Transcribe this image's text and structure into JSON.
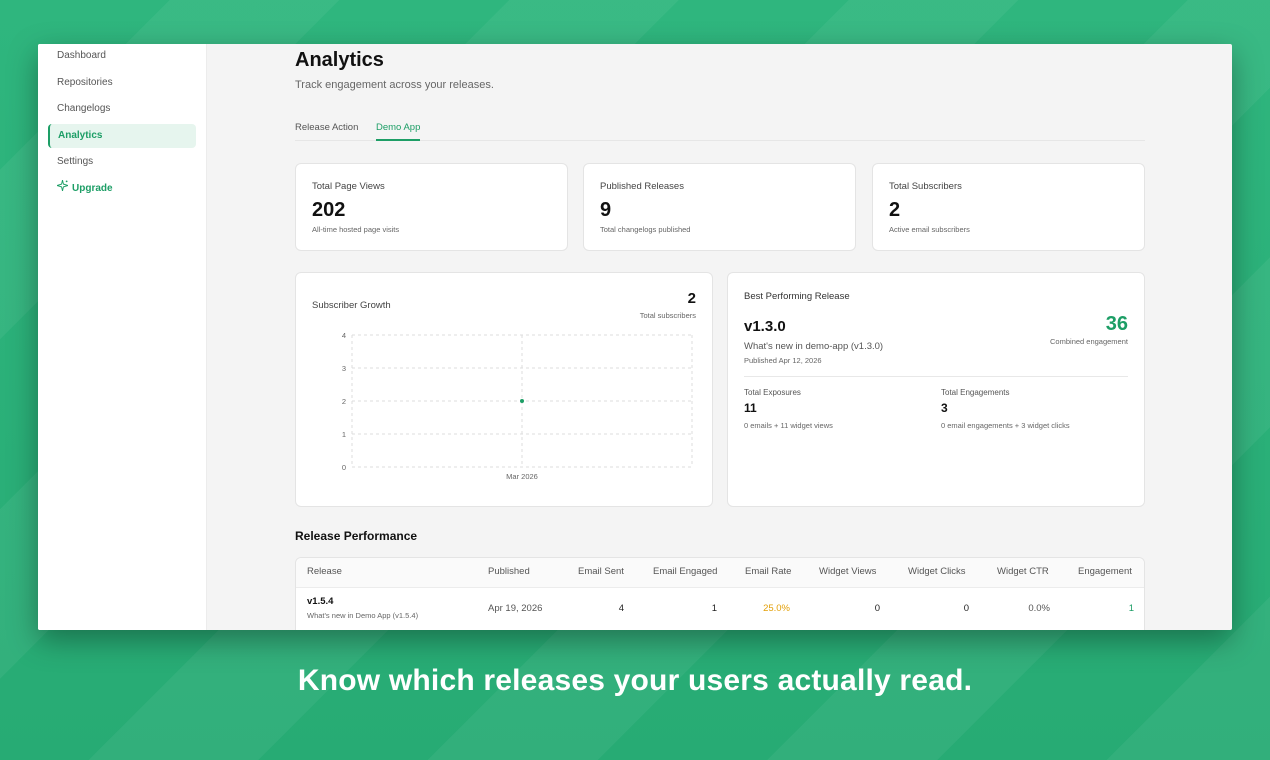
{
  "sidebar": {
    "items": [
      {
        "label": "Dashboard"
      },
      {
        "label": "Repositories"
      },
      {
        "label": "Changelogs"
      },
      {
        "label": "Analytics"
      },
      {
        "label": "Settings"
      },
      {
        "label": "Upgrade"
      }
    ]
  },
  "header": {
    "title": "Analytics",
    "subtitle": "Track engagement across your releases."
  },
  "tabs": [
    {
      "label": "Release Action"
    },
    {
      "label": "Demo App"
    }
  ],
  "stats": [
    {
      "label": "Total Page Views",
      "value": "202",
      "desc": "All-time hosted page visits"
    },
    {
      "label": "Published Releases",
      "value": "9",
      "desc": "Total changelogs published"
    },
    {
      "label": "Total Subscribers",
      "value": "2",
      "desc": "Active email subscribers"
    }
  ],
  "subscriber_chart": {
    "title": "Subscriber Growth",
    "total": "2",
    "total_label": "Total subscribers"
  },
  "chart_data": {
    "type": "line",
    "title": "Subscriber Growth",
    "x": [
      "Mar 2026"
    ],
    "series": [
      {
        "values": [
          2
        ]
      }
    ],
    "xlabel": "",
    "ylabel": "",
    "ylim": [
      0,
      4
    ],
    "yticks": [
      "0",
      "1",
      "2",
      "3",
      "4"
    ],
    "grid": true,
    "color": "#1d9e66"
  },
  "best": {
    "title": "Best Performing Release",
    "version": "v1.3.0",
    "name": "What's new in demo-app (v1.3.0)",
    "date": "Published Apr 12, 2026",
    "score": "36",
    "score_label": "Combined engagement",
    "exposures_label": "Total Exposures",
    "exposures_value": "11",
    "exposures_desc": "0 emails + 11 widget views",
    "engagements_label": "Total Engagements",
    "engagements_value": "3",
    "engagements_desc": "0 email engagements + 3 widget clicks"
  },
  "performance": {
    "title": "Release Performance",
    "columns": [
      "Release",
      "Published",
      "Email Sent",
      "Email Engaged",
      "Email Rate",
      "Widget Views",
      "Widget Clicks",
      "Widget CTR",
      "Engagement"
    ],
    "rows": [
      {
        "release": "v1.5.4",
        "release_name": "What's new in Demo App (v1.5.4)",
        "published": "Apr 19, 2026",
        "email_sent": "4",
        "email_engaged": "1",
        "email_rate": "25.0%",
        "widget_views": "0",
        "widget_clicks": "0",
        "widget_ctr": "0.0%",
        "engagement": "1"
      }
    ]
  },
  "caption": "Know which releases your users actually read.",
  "colors": {
    "accent": "#1d9e66",
    "rate_color": "#e3a008",
    "background": "#2bb27a"
  }
}
